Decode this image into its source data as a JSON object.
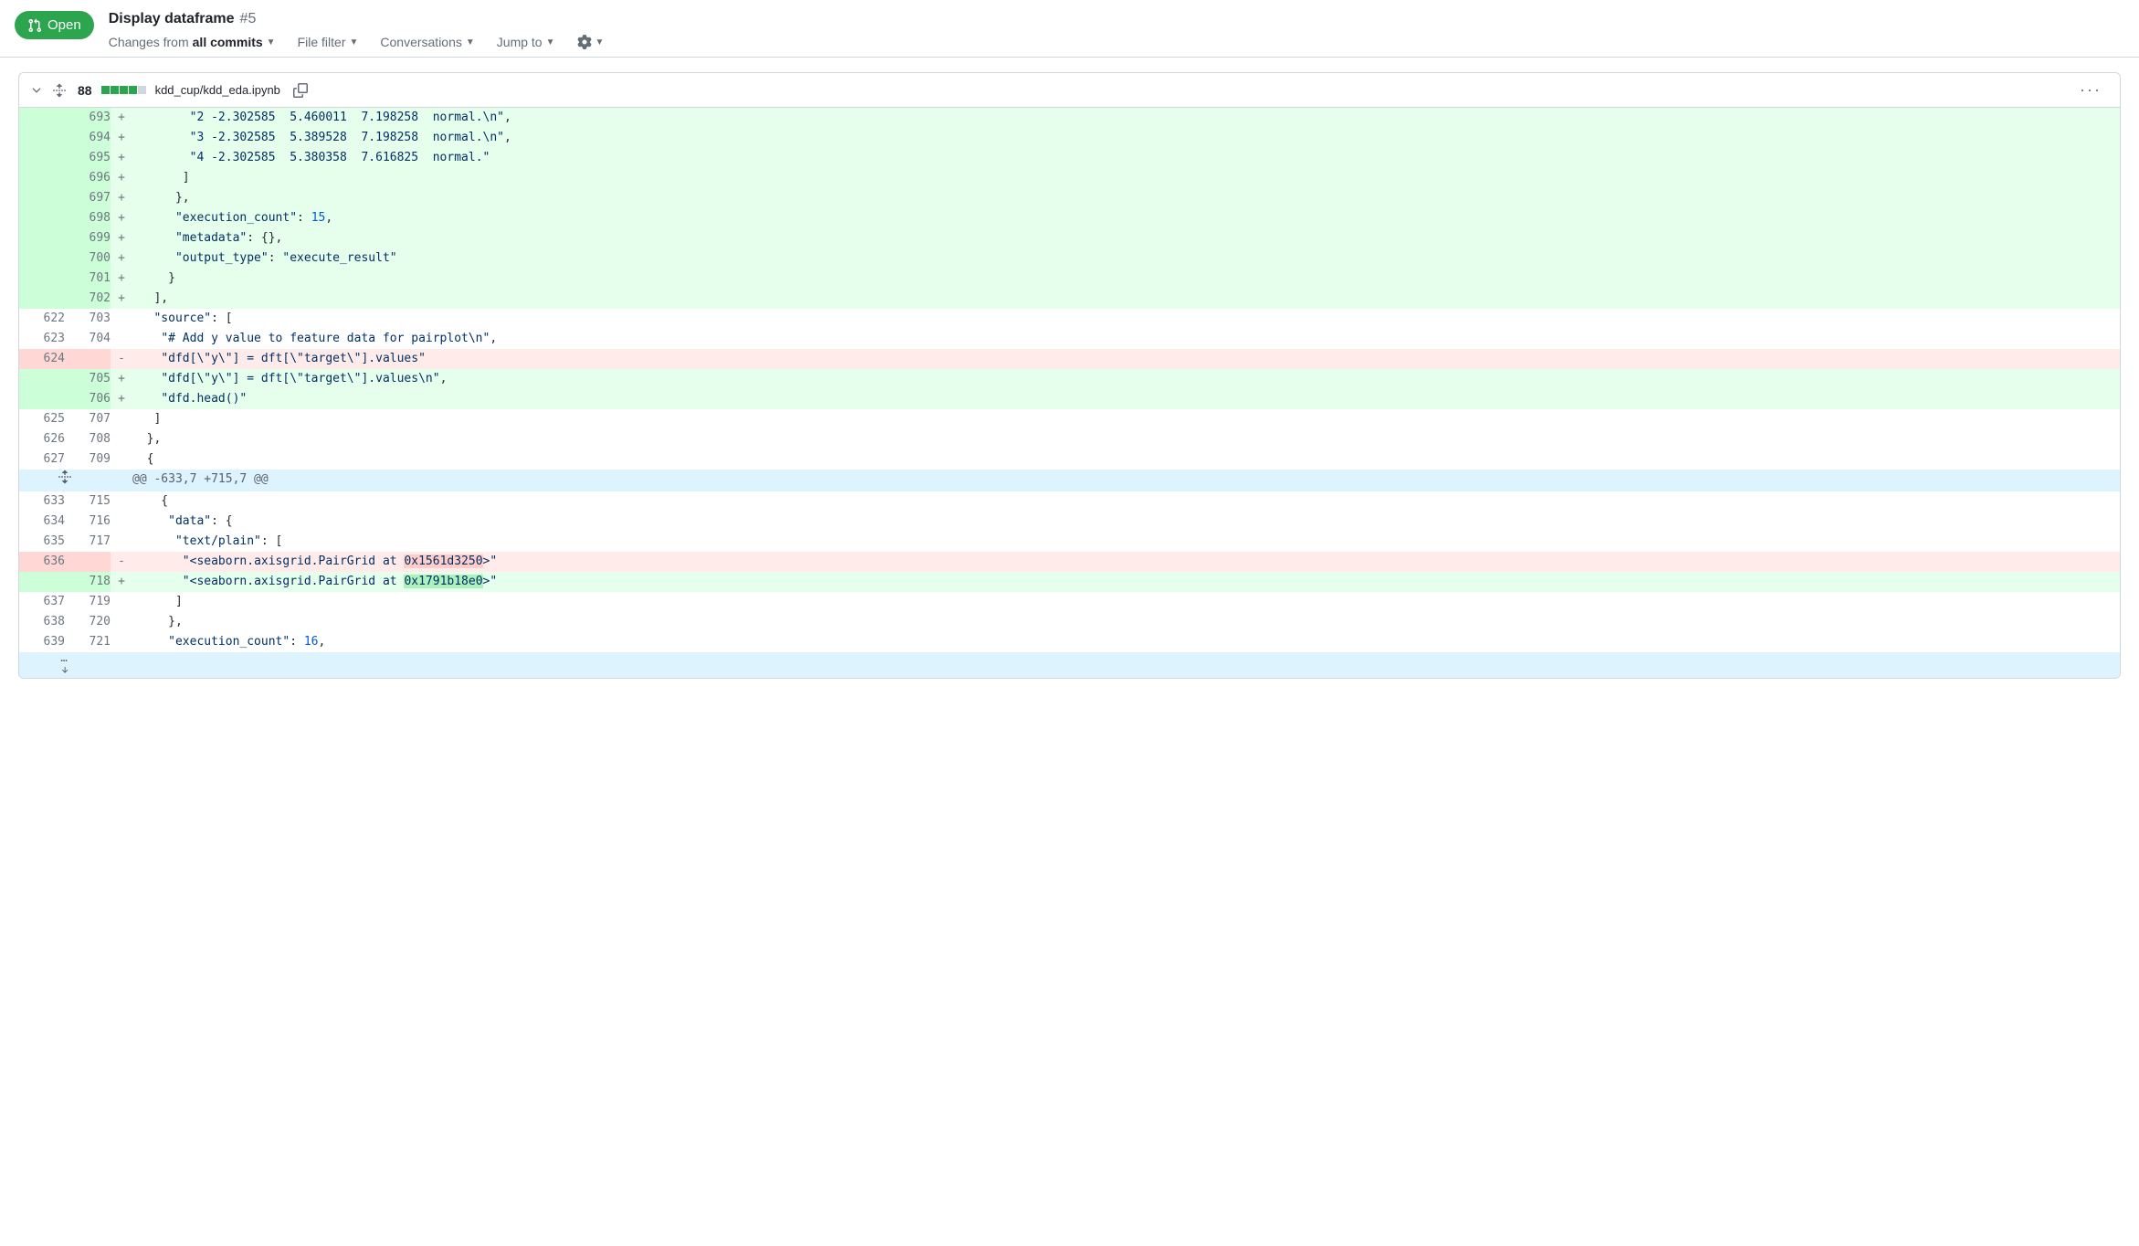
{
  "header": {
    "open_label": "Open",
    "title": "Display dataframe",
    "number": "#5"
  },
  "toolbar": {
    "changes_prefix": "Changes from ",
    "changes_scope": "all commits",
    "file_filter": "File filter",
    "conversations": "Conversations",
    "jump_to": "Jump to"
  },
  "file": {
    "change_count": "88",
    "path": "kdd_cup/kdd_eda.ipynb"
  },
  "hunk": {
    "label": "@@ -633,7 +715,7 @@"
  },
  "rows": [
    {
      "type": "addition",
      "old": "",
      "new": "693",
      "segments": [
        {
          "t": "        ",
          "c": ""
        },
        {
          "t": "\"2 -2.302585  5.460011  7.198258  normal.\\n\"",
          "c": "s"
        },
        {
          "t": ",",
          "c": ""
        }
      ]
    },
    {
      "type": "addition",
      "old": "",
      "new": "694",
      "segments": [
        {
          "t": "        ",
          "c": ""
        },
        {
          "t": "\"3 -2.302585  5.389528  7.198258  normal.\\n\"",
          "c": "s"
        },
        {
          "t": ",",
          "c": ""
        }
      ]
    },
    {
      "type": "addition",
      "old": "",
      "new": "695",
      "segments": [
        {
          "t": "        ",
          "c": ""
        },
        {
          "t": "\"4 -2.302585  5.380358  7.616825  normal.\"",
          "c": "s"
        }
      ]
    },
    {
      "type": "addition",
      "old": "",
      "new": "696",
      "segments": [
        {
          "t": "       ]",
          "c": ""
        }
      ]
    },
    {
      "type": "addition",
      "old": "",
      "new": "697",
      "segments": [
        {
          "t": "      },",
          "c": ""
        }
      ]
    },
    {
      "type": "addition",
      "old": "",
      "new": "698",
      "segments": [
        {
          "t": "      ",
          "c": ""
        },
        {
          "t": "\"execution_count\"",
          "c": "s"
        },
        {
          "t": ": ",
          "c": ""
        },
        {
          "t": "15",
          "c": "n"
        },
        {
          "t": ",",
          "c": ""
        }
      ]
    },
    {
      "type": "addition",
      "old": "",
      "new": "699",
      "segments": [
        {
          "t": "      ",
          "c": ""
        },
        {
          "t": "\"metadata\"",
          "c": "s"
        },
        {
          "t": ": {},",
          "c": ""
        }
      ]
    },
    {
      "type": "addition",
      "old": "",
      "new": "700",
      "segments": [
        {
          "t": "      ",
          "c": ""
        },
        {
          "t": "\"output_type\"",
          "c": "s"
        },
        {
          "t": ": ",
          "c": ""
        },
        {
          "t": "\"execute_result\"",
          "c": "s"
        }
      ]
    },
    {
      "type": "addition",
      "old": "",
      "new": "701",
      "segments": [
        {
          "t": "     }",
          "c": ""
        }
      ]
    },
    {
      "type": "addition",
      "old": "",
      "new": "702",
      "segments": [
        {
          "t": "   ],",
          "c": ""
        }
      ]
    },
    {
      "type": "context",
      "old": "622",
      "new": "703",
      "segments": [
        {
          "t": "   ",
          "c": ""
        },
        {
          "t": "\"source\"",
          "c": "s"
        },
        {
          "t": ": [",
          "c": ""
        }
      ]
    },
    {
      "type": "context",
      "old": "623",
      "new": "704",
      "segments": [
        {
          "t": "    ",
          "c": ""
        },
        {
          "t": "\"# Add y value to feature data for pairplot\\n\"",
          "c": "s"
        },
        {
          "t": ",",
          "c": ""
        }
      ]
    },
    {
      "type": "deletion",
      "old": "624",
      "new": "",
      "segments": [
        {
          "t": "    ",
          "c": ""
        },
        {
          "t": "\"dfd[\\\"y\\\"] = dft[\\\"target\\\"].values\"",
          "c": "s"
        }
      ]
    },
    {
      "type": "addition",
      "old": "",
      "new": "705",
      "segments": [
        {
          "t": "    ",
          "c": ""
        },
        {
          "t": "\"dfd[\\\"y\\\"] = dft[\\\"target\\\"].values\\n\"",
          "c": "s"
        },
        {
          "t": ",",
          "c": ""
        }
      ]
    },
    {
      "type": "addition",
      "old": "",
      "new": "706",
      "segments": [
        {
          "t": "    ",
          "c": ""
        },
        {
          "t": "\"dfd.head()\"",
          "c": "s"
        }
      ]
    },
    {
      "type": "context",
      "old": "625",
      "new": "707",
      "segments": [
        {
          "t": "   ]",
          "c": ""
        }
      ]
    },
    {
      "type": "context",
      "old": "626",
      "new": "708",
      "segments": [
        {
          "t": "  },",
          "c": ""
        }
      ]
    },
    {
      "type": "context",
      "old": "627",
      "new": "709",
      "segments": [
        {
          "t": "  {",
          "c": ""
        }
      ]
    }
  ],
  "rows2": [
    {
      "type": "context",
      "old": "633",
      "new": "715",
      "segments": [
        {
          "t": "    {",
          "c": ""
        }
      ]
    },
    {
      "type": "context",
      "old": "634",
      "new": "716",
      "segments": [
        {
          "t": "     ",
          "c": ""
        },
        {
          "t": "\"data\"",
          "c": "s"
        },
        {
          "t": ": {",
          "c": ""
        }
      ]
    },
    {
      "type": "context",
      "old": "635",
      "new": "717",
      "segments": [
        {
          "t": "      ",
          "c": ""
        },
        {
          "t": "\"text/plain\"",
          "c": "s"
        },
        {
          "t": ": [",
          "c": ""
        }
      ]
    },
    {
      "type": "deletion",
      "old": "636",
      "new": "",
      "segments": [
        {
          "t": "       ",
          "c": ""
        },
        {
          "t": "\"<seaborn.axisgrid.PairGrid at ",
          "c": "s"
        },
        {
          "t": "0x1561d3250",
          "c": "s hexdel"
        },
        {
          "t": ">\"",
          "c": "s"
        }
      ]
    },
    {
      "type": "addition",
      "old": "",
      "new": "718",
      "segments": [
        {
          "t": "       ",
          "c": ""
        },
        {
          "t": "\"<seaborn.axisgrid.PairGrid at ",
          "c": "s"
        },
        {
          "t": "0x1791b18e0",
          "c": "s hexadd"
        },
        {
          "t": ">\"",
          "c": "s"
        }
      ]
    },
    {
      "type": "context",
      "old": "637",
      "new": "719",
      "segments": [
        {
          "t": "      ]",
          "c": ""
        }
      ]
    },
    {
      "type": "context",
      "old": "638",
      "new": "720",
      "segments": [
        {
          "t": "     },",
          "c": ""
        }
      ]
    },
    {
      "type": "context",
      "old": "639",
      "new": "721",
      "segments": [
        {
          "t": "     ",
          "c": ""
        },
        {
          "t": "\"execution_count\"",
          "c": "s"
        },
        {
          "t": ": ",
          "c": ""
        },
        {
          "t": "16",
          "c": "n"
        },
        {
          "t": ",",
          "c": ""
        }
      ]
    }
  ]
}
